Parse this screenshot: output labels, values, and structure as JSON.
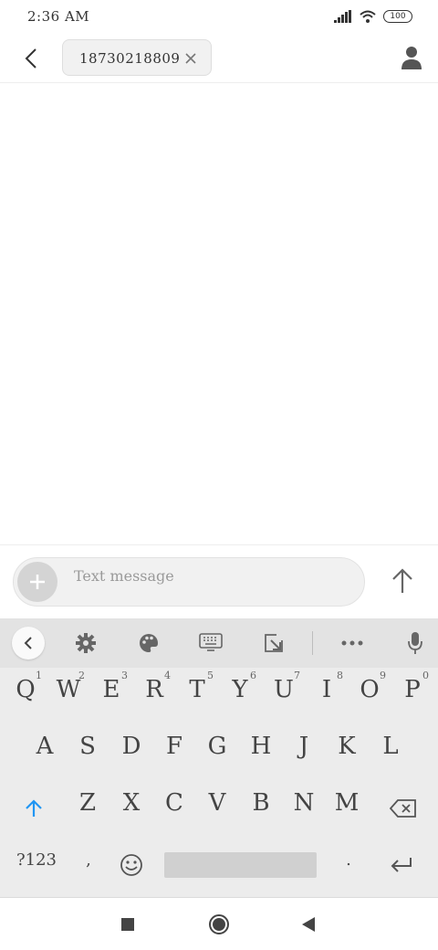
{
  "status_bar": {
    "time": "2:36 AM",
    "battery": "100",
    "signal_icon": "signal-icon",
    "wifi_icon": "wifi-icon"
  },
  "header": {
    "back_icon": "back-arrow-icon",
    "recipient": "18730218809",
    "remove_icon": "close-icon",
    "contact_icon": "person-icon"
  },
  "compose": {
    "placeholder": "Text message",
    "attach_icon": "plus-icon",
    "send_icon": "send-arrow-icon"
  },
  "keyboard": {
    "toolbar": [
      "chevron-left-icon",
      "gear-icon",
      "palette-icon",
      "keyboard-icon",
      "resize-icon",
      "more-icon",
      "microphone-icon"
    ],
    "row1": [
      {
        "label": "Q",
        "hint": "1"
      },
      {
        "label": "W",
        "hint": "2"
      },
      {
        "label": "E",
        "hint": "3"
      },
      {
        "label": "R",
        "hint": "4"
      },
      {
        "label": "T",
        "hint": "5"
      },
      {
        "label": "Y",
        "hint": "6"
      },
      {
        "label": "U",
        "hint": "7"
      },
      {
        "label": "I",
        "hint": "8"
      },
      {
        "label": "O",
        "hint": "9"
      },
      {
        "label": "P",
        "hint": "0"
      }
    ],
    "row2": [
      "A",
      "S",
      "D",
      "F",
      "G",
      "H",
      "J",
      "K",
      "L"
    ],
    "row3": [
      "Z",
      "X",
      "C",
      "V",
      "B",
      "N",
      "M"
    ],
    "row4": {
      "symbols": "?123",
      "comma": ",",
      "period": "."
    },
    "shift_icon": "shift-arrow-icon",
    "backspace_icon": "backspace-icon",
    "emoji_icon": "emoji-icon",
    "enter_icon": "enter-icon"
  },
  "nav_bar": [
    "recents-square-icon",
    "home-circle-icon",
    "back-triangle-icon"
  ],
  "colors": {
    "accent": "#2196f3",
    "keyboard_bg": "#ececec",
    "toolbar_bg": "#e3e3e3",
    "chip_bg": "#f1f1f1"
  }
}
